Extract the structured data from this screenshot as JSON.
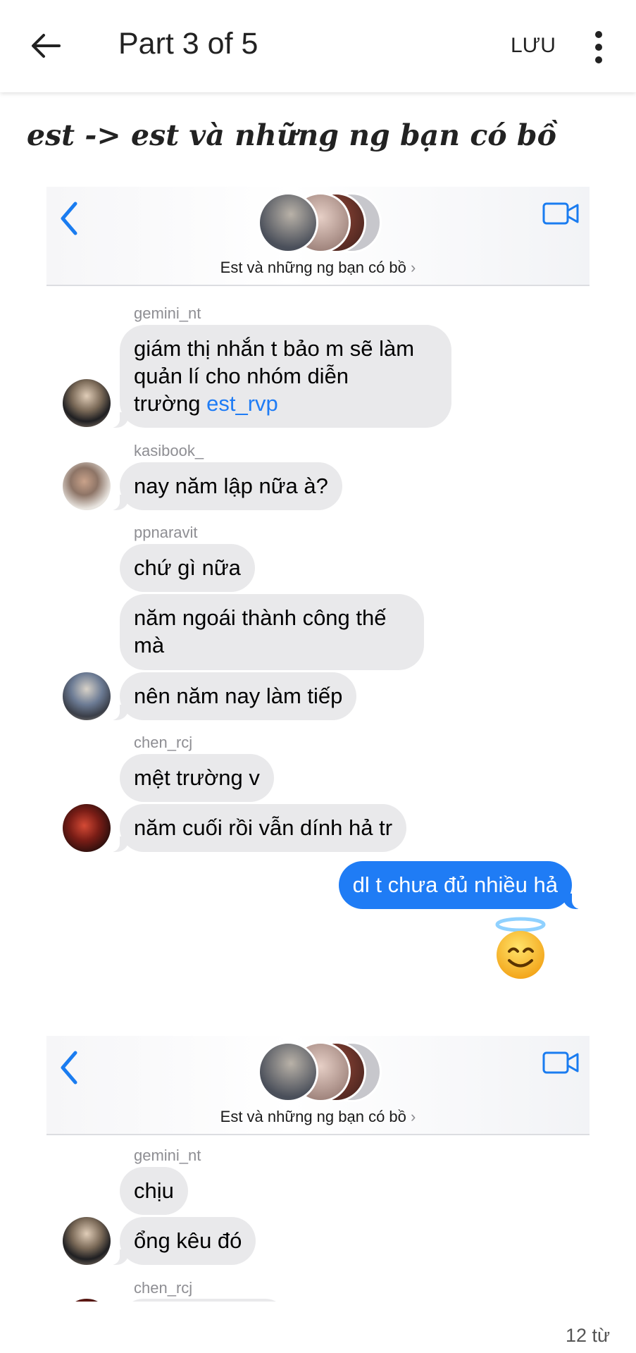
{
  "appbar": {
    "title": "Part 3 of 5",
    "save_label": "LƯU"
  },
  "story": {
    "heading": "est -> est và những ng bạn có bồ"
  },
  "chat": {
    "group_name": "Est và những ng bạn có bồ"
  },
  "shot1": {
    "messages": [
      {
        "sender": "gemini_nt",
        "text_lines": [
          "giám thị nhắn t bảo m sẽ làm",
          "quản lí cho nhóm diễn"
        ],
        "text_last_prefix": "trường ",
        "mention": "est_rvp"
      },
      {
        "sender": "kasibook_",
        "text": "nay năm lập nữa à?"
      },
      {
        "sender": "ppnaravit",
        "texts": [
          "chứ gì nữa",
          "năm ngoái thành công thế",
          "mà",
          "nên năm nay làm tiếp"
        ]
      },
      {
        "sender": "chen_rcj",
        "texts": [
          "mệt trường v",
          "năm cuối rồi vẫn dính hả tr"
        ]
      },
      {
        "sender": "",
        "text": "dl t chưa đủ nhiều hả",
        "icon": "smiling-face-with-halo-icon"
      }
    ]
  },
  "shot2": {
    "messages": [
      {
        "sender": "gemini_nt",
        "texts": [
          "chịu",
          "ổng kêu đó"
        ]
      },
      {
        "sender": "chen_rcj"
      }
    ]
  },
  "footer": {
    "word_count": "12 từ"
  },
  "colors": {
    "accent": "#1f7cf5",
    "bubble_received": "#e9e9eb",
    "ios_blue": "#1a7cf0"
  }
}
